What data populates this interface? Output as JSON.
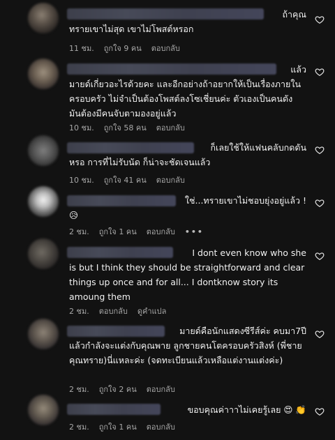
{
  "comments": [
    {
      "first_line": "ถ้าคุณ",
      "body": "ทรายเขาไม่สุด เขาไม่โพสต์หรอก",
      "time": "11 ชม.",
      "likes": "ถูกใจ 9 คน",
      "reply": "ตอบกลับ"
    },
    {
      "first_line": "แล้ว",
      "body": "มายด์เกี่ยวอะไรด้วยคะ และอีกอย่างถ้าอยากให้เป็นเรื่องภายในครอบครัว ไม่จำเป็นต้องโพสต์ลงโซเชี่ยนค่ะ ตัวเองเป็นคนดัง มันต้องมีคนจับตามองอยู่แล้ว",
      "time": "10 ชม.",
      "likes": "ถูกใจ 58 คน",
      "reply": "ตอบกลับ"
    },
    {
      "first_line": "ก็เลยใช้ให้แฟนคลับกดดัน",
      "body": "หรอ การที่ไม่รับนัด ก็น่าจะชัดเจนแล้ว",
      "time": "10 ชม.",
      "likes": "ถูกใจ 41 คน",
      "reply": "ตอบกลับ"
    },
    {
      "first_line": "ใช่...ทรายเขาไม่ชอบยุ่งอยู่แล้ว !",
      "body": "😥",
      "time": "2 ชม.",
      "likes": "ถูกใจ 1 คน",
      "reply": "ตอบกลับ",
      "more": "•••"
    },
    {
      "first_line": "I dont even know who she",
      "body": "is but I think they should be straightforward and clear things up once and for all... I dontknow story its amoung them",
      "time": "2 ชม.",
      "reply": "ตอบกลับ",
      "translate": "ดูคำแปล"
    },
    {
      "first_line": "มายด์คือนักแสดงซีรีส์ค่ะ คบมา7ปี",
      "body": "แล้วกำลังจะแต่งกับคุณพาย ลูกชายคนโตครอบครัวสิงห์ (พี่ชายคุณทราย)นี่แหละค่ะ (จดทะเบียนแล้วเหลือแต่งานแต่งค่ะ)",
      "time": "2 ชม.",
      "likes": "ถูกใจ 2 คน",
      "reply": "ตอบกลับ"
    },
    {
      "first_line": "ขอบคุณค่าาาไม่เคยรู้เลย 😍 👏",
      "body": "",
      "time": "2 ชม.",
      "likes": "ถูกใจ 1 คน",
      "reply": "ตอบกลับ"
    }
  ]
}
